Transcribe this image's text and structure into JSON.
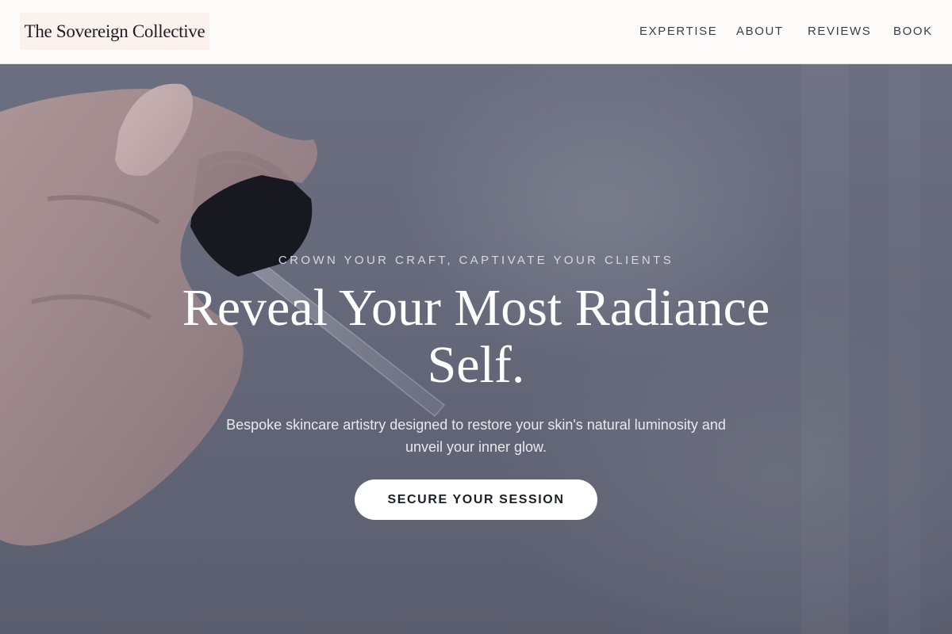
{
  "brand": {
    "name": "The Sovereign Collective"
  },
  "nav": {
    "items": [
      {
        "label": "EXPERTISE"
      },
      {
        "label": "ABOUT"
      },
      {
        "label": "REVIEWS"
      },
      {
        "label": "BOOK"
      }
    ]
  },
  "hero": {
    "eyebrow": "CROWN YOUR CRAFT, CAPTIVATE YOUR CLIENTS",
    "headline": "Reveal Your Most Radiance Self.",
    "subtext": "Bespoke skincare artistry designed to restore your skin's natural luminosity and unveil your inner glow.",
    "cta_label": "SECURE YOUR SESSION",
    "background_image": "hand-holding-serum-dropper"
  },
  "colors": {
    "header_bg": "#fefcfb",
    "logo_bg": "#fbf2ee",
    "hero_bg": "#6d7182",
    "cta_bg": "#ffffff",
    "cta_text": "#1c1d27"
  }
}
